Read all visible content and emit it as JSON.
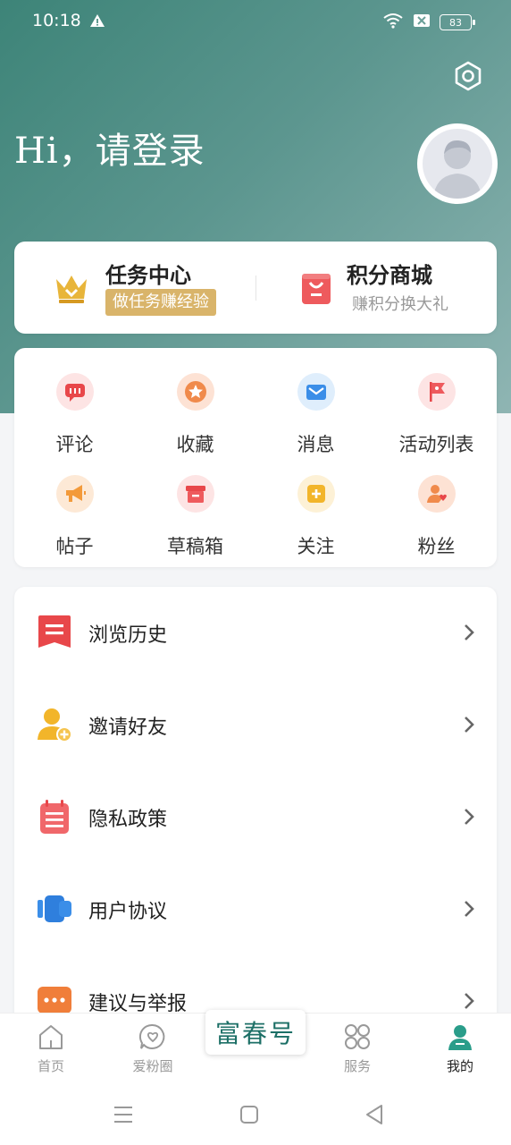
{
  "status": {
    "time": "10:18",
    "battery": "83"
  },
  "header": {
    "greeting": "Hi，请登录"
  },
  "quick": {
    "tasks": {
      "title": "任务中心",
      "subtitle": "做任务赚经验"
    },
    "mall": {
      "title": "积分商城",
      "subtitle": "赚积分换大礼"
    }
  },
  "grid": [
    {
      "label": "评论",
      "icon": "comment-icon"
    },
    {
      "label": "收藏",
      "icon": "star-icon"
    },
    {
      "label": "消息",
      "icon": "message-icon"
    },
    {
      "label": "活动列表",
      "icon": "flag-icon"
    },
    {
      "label": "帖子",
      "icon": "megaphone-icon"
    },
    {
      "label": "草稿箱",
      "icon": "drafts-box-icon"
    },
    {
      "label": "关注",
      "icon": "follow-icon"
    },
    {
      "label": "粉丝",
      "icon": "fans-icon"
    }
  ],
  "list": [
    {
      "label": "浏览历史",
      "icon": "history-icon"
    },
    {
      "label": "邀请好友",
      "icon": "invite-friend-icon"
    },
    {
      "label": "隐私政策",
      "icon": "privacy-icon"
    },
    {
      "label": "用户协议",
      "icon": "agreement-icon"
    },
    {
      "label": "建议与举报",
      "icon": "feedback-icon"
    }
  ],
  "tabs": [
    {
      "label": "首页",
      "icon": "home-icon"
    },
    {
      "label": "爱粉圈",
      "icon": "fan-circle-icon"
    },
    {
      "label": "服务",
      "icon": "services-icon"
    },
    {
      "label": "我的",
      "icon": "profile-icon"
    }
  ],
  "center_logo": "富春号",
  "colors": {
    "accent": "#3d8478",
    "gold": "#d9b46a",
    "red": "#e8474a"
  }
}
